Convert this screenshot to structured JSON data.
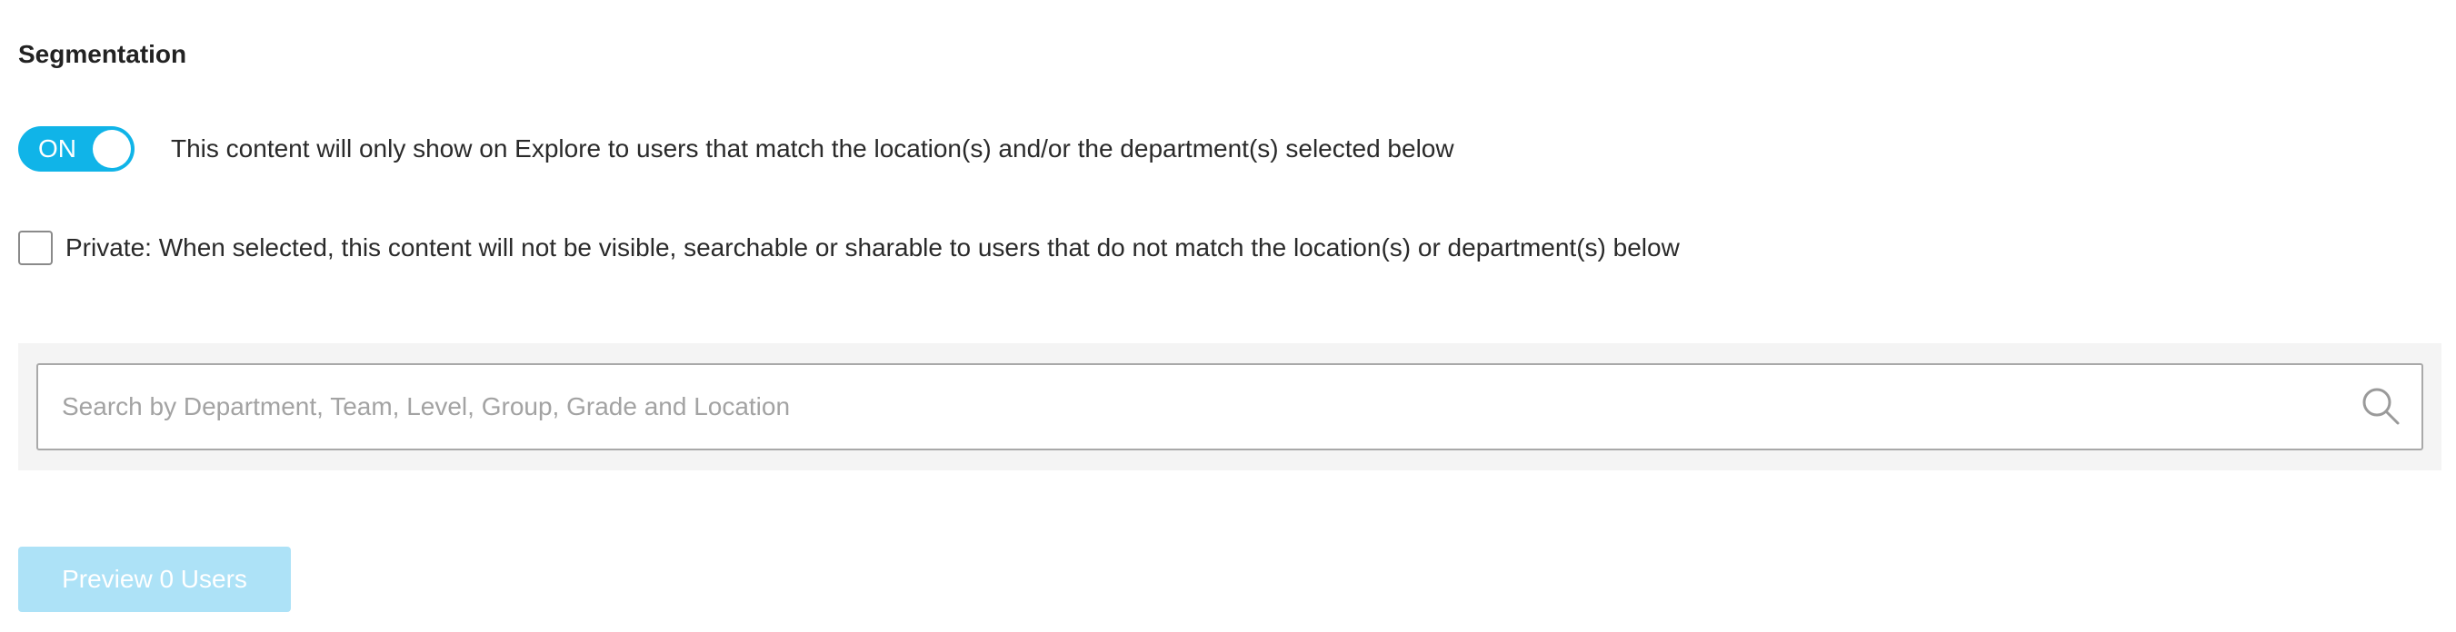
{
  "segmentation": {
    "title": "Segmentation",
    "toggle": {
      "state_label": "ON",
      "is_on": true,
      "description": "This content will only show on Explore to users that match the location(s) and/or the department(s) selected below"
    },
    "private_checkbox": {
      "checked": false,
      "label": "Private: When selected, this content will not be visible, searchable or sharable to users that do not match the location(s) or department(s) below"
    },
    "search": {
      "placeholder": "Search by Department, Team, Level, Group, Grade and Location",
      "value": "",
      "icon": "search-icon"
    },
    "preview_button": {
      "label": "Preview 0 Users",
      "disabled": true
    },
    "colors": {
      "accent": "#10b4e8",
      "button_disabled": "#ade2f7",
      "panel_background": "#f4f4f4"
    }
  }
}
